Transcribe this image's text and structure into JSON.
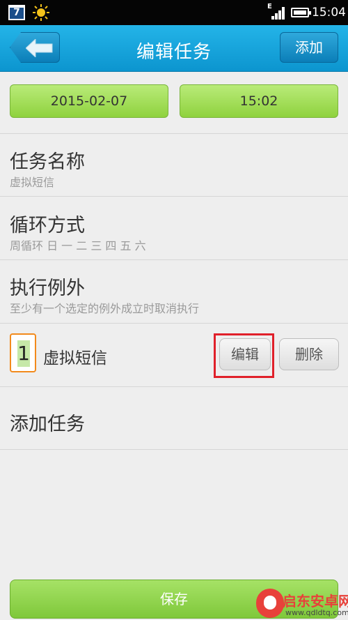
{
  "statusbar": {
    "calendar_day": "7",
    "network_type": "E",
    "time": "15:04"
  },
  "titlebar": {
    "title": "编辑任务",
    "add_label": "添加"
  },
  "schedule": {
    "date": "2015-02-07",
    "time": "15:02"
  },
  "task_name": {
    "label": "任务名称",
    "value": "虚拟短信"
  },
  "repeat": {
    "label": "循环方式",
    "value": "周循环 日 一 二 三 四 五 六"
  },
  "exceptions": {
    "label": "执行例外",
    "hint": "至少有一个选定的例外成立时取消执行",
    "items": [
      {
        "index": "1",
        "name": "虚拟短信",
        "edit_label": "编辑",
        "delete_label": "删除"
      }
    ]
  },
  "add_task_label": "添加任务",
  "save_label": "保存",
  "watermark": {
    "name": "启东安卓网",
    "url": "www.qdldtq.com"
  },
  "colors": {
    "title_bar": "#1aa9e0",
    "green_button": "#9bd84d",
    "highlight": "#e0202a",
    "index_border": "#f28a1c"
  }
}
